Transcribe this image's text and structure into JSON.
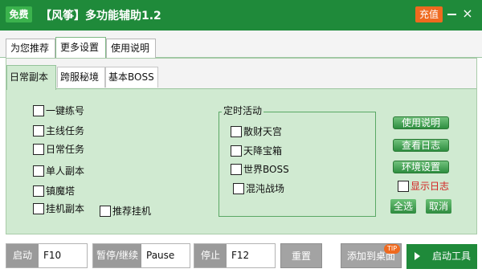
{
  "titlebar": {
    "free_badge": "免费",
    "title": "【风筝】多功能辅助1.2",
    "recharge": "充值",
    "close_glyph": "×"
  },
  "top_tabs": [
    "为您推荐",
    "更多设置",
    "使用说明"
  ],
  "active_top_tab": "更多设置",
  "sub_tabs": [
    "日常副本",
    "跨服秘境",
    "基本BOSS"
  ],
  "active_sub_tab": "日常副本",
  "left_options": [
    {
      "label": "一键练号",
      "checked": false
    },
    {
      "label": "主线任务",
      "checked": false
    },
    {
      "label": "日常任务",
      "checked": false
    },
    {
      "label": "单人副本",
      "checked": false
    },
    {
      "label": "镇魔塔",
      "checked": false
    },
    {
      "label": "挂机副本",
      "checked": false
    }
  ],
  "recommend_afk": {
    "label": "推荐挂机",
    "checked": false
  },
  "timed_events": {
    "title": "定时活动",
    "items": [
      {
        "label": "散财天宫",
        "checked": false
      },
      {
        "label": "天降宝箱",
        "checked": false
      },
      {
        "label": "世界BOSS",
        "checked": false
      },
      {
        "label": "混沌战场",
        "checked": false
      }
    ]
  },
  "side_buttons": [
    "使用说明",
    "查看日志",
    "环境设置"
  ],
  "show_log": {
    "label": "显示日志",
    "checked": false
  },
  "select_all": "全选",
  "cancel": "取消",
  "bottom": {
    "start_label": "启动",
    "start_key": "F10",
    "pause_label": "暂停/继续",
    "pause_key": "Pause",
    "stop_label": "停止",
    "stop_key": "F12",
    "reset": "重置",
    "add_desktop": "添加到桌面",
    "tip_badge": "TIP",
    "start_tool": "启动工具"
  },
  "colors": {
    "brand_green": "#1f8a3a",
    "panel_green": "#d0ead1",
    "accent_orange": "#ef6a1f",
    "warning_red": "#d42020"
  }
}
